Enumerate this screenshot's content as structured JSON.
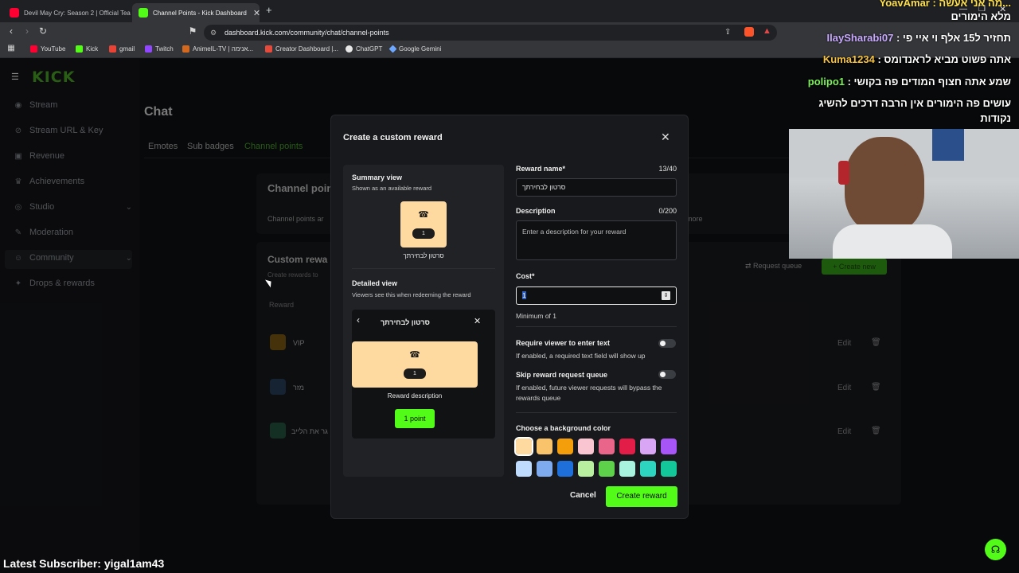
{
  "browser": {
    "tabs": [
      {
        "title": "Devil May Cry: Season 2 | Official Tea",
        "favicon": "youtube-icon"
      },
      {
        "title": "Channel Points - Kick Dashboard",
        "favicon": "kick-icon"
      }
    ],
    "url": "dashboard.kick.com/community/chat/channel-points",
    "bookmarks": [
      "YouTube",
      "Kick",
      "gmail",
      "Twitch",
      "AnimeIL-TV | אנימה...",
      "Creator Dashboard |...",
      "ChatGPT",
      "Google Gemini"
    ]
  },
  "sidebar": {
    "logo": "KICK",
    "items": [
      {
        "label": "Stream",
        "icon": "broadcast-icon"
      },
      {
        "label": "Stream URL & Key",
        "icon": "link-icon"
      },
      {
        "label": "Revenue",
        "icon": "wallet-icon"
      },
      {
        "label": "Achievements",
        "icon": "trophy-icon"
      },
      {
        "label": "Studio",
        "icon": "globe-icon"
      },
      {
        "label": "Moderation",
        "icon": "wrench-icon"
      },
      {
        "label": "Community",
        "icon": "users-icon"
      },
      {
        "label": "Drops & rewards",
        "icon": "gift-icon"
      }
    ]
  },
  "main": {
    "page_title": "Chat",
    "tabs": [
      "Emotes",
      "Sub badges",
      "Channel points"
    ],
    "section_title": "Channel point",
    "section_desc": "Channel points ar",
    "more_link": "more",
    "custom_title": "Custom rewa",
    "custom_desc": "Create rewards to",
    "request_queue": "Request queue",
    "create_new": "Create new",
    "reward_header": "Reward",
    "rewards": [
      {
        "name": "VIP",
        "edit": "Edit"
      },
      {
        "name": "מזר",
        "edit": "Edit"
      },
      {
        "name": "גר את הלייב",
        "edit": "Edit"
      }
    ]
  },
  "modal": {
    "title": "Create a custom reward",
    "summary_title": "Summary view",
    "summary_sub": "Shown as an available reward",
    "reward_name_preview": "סרטון לבחירתך",
    "cost_preview": "1",
    "detailed_title": "Detailed view",
    "detailed_sub": "Viewers see this when redeeming the reward",
    "reward_description_preview": "Reward description",
    "points_button": "1 point",
    "name_label": "Reward name*",
    "name_count": "13/40",
    "name_value": "סרטון לבחירתך",
    "desc_label": "Description",
    "desc_count": "0/200",
    "desc_placeholder": "Enter a description for your reward",
    "cost_label": "Cost*",
    "cost_value": "1",
    "cost_hint": "Minimum of 1",
    "require_label": "Require viewer to enter text",
    "require_hint": "If enabled, a required text field will show up",
    "skip_label": "Skip reward request queue",
    "skip_hint": "If enabled, future viewer requests will bypass the rewards queue",
    "color_label": "Choose a background color",
    "colors": [
      "#fed9a0",
      "#f8c36b",
      "#f59e0b",
      "#f9c5d1",
      "#e9668a",
      "#e11d48",
      "#d8a6f5",
      "#a855f7",
      "#bfdbfe",
      "#7eaaf0",
      "#1e6fd9",
      "#b9f0a0",
      "#5ed14a",
      "#a7f3e0",
      "#2dd4bf",
      "#14c79a"
    ],
    "selected_color": "#fed9a0",
    "cancel": "Cancel",
    "create": "Create reward"
  },
  "overlay": {
    "chat": [
      {
        "user": "",
        "text": "...מה אני אעשה : YoavAmar",
        "color": "#ffe14d"
      },
      {
        "user": "",
        "text": "מלא הימורים",
        "color": "#ffffff"
      },
      {
        "user": "IlaySharabi07",
        "text": "תחזיר ל15 אלף וי איי פי :",
        "color": "#c8a9ff"
      },
      {
        "user": "Kuma1234",
        "text": "אתה פשוט מביא לראנדומס :",
        "color": "#f5c242"
      },
      {
        "user": "polipo1",
        "text": "שמע אתה חצוף המודים פה בקושי :",
        "color": "#7cf25a"
      },
      {
        "user": "",
        "text": "עושים פה הימורים אין הרבה דרכים להשיג",
        "color": "#ffffff"
      },
      {
        "user": "",
        "text": "נקודות",
        "color": "#ffffff"
      }
    ],
    "latest_subscriber": "Latest Subscriber: yigal1am43"
  },
  "colors": {
    "kick_green": "#53fc18",
    "accent_dark": "#18191c"
  }
}
